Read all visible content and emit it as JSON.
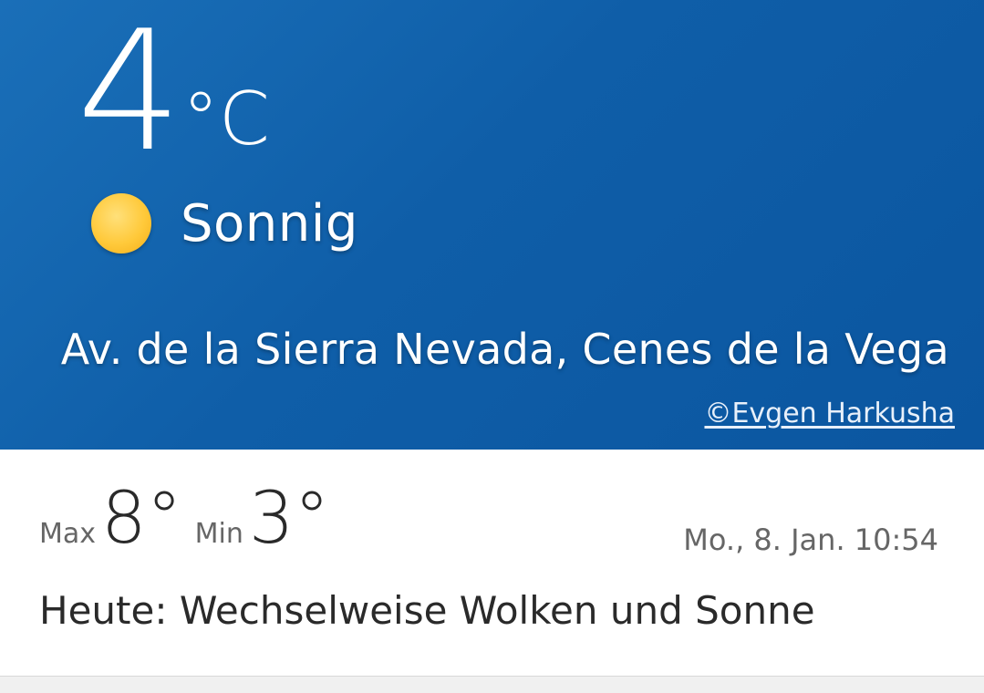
{
  "current": {
    "temperature": "4",
    "unit": "°C",
    "condition": "Sonnig",
    "condition_icon": "sun-icon",
    "location": "Av. de la Sierra Nevada, Cenes de la Vega",
    "photo_credit": "©Evgen Harkusha"
  },
  "details": {
    "max_label": "Max",
    "max_value": "8°",
    "min_label": "Min",
    "min_value": "3°",
    "datetime": "Mo., 8. Jan. 10:54",
    "forecast": "Heute: Wechselweise Wolken und Sonne"
  },
  "colors": {
    "hero_background": "#0f5ea8",
    "sun": "#ffc93a",
    "details_background": "#ffffff"
  }
}
